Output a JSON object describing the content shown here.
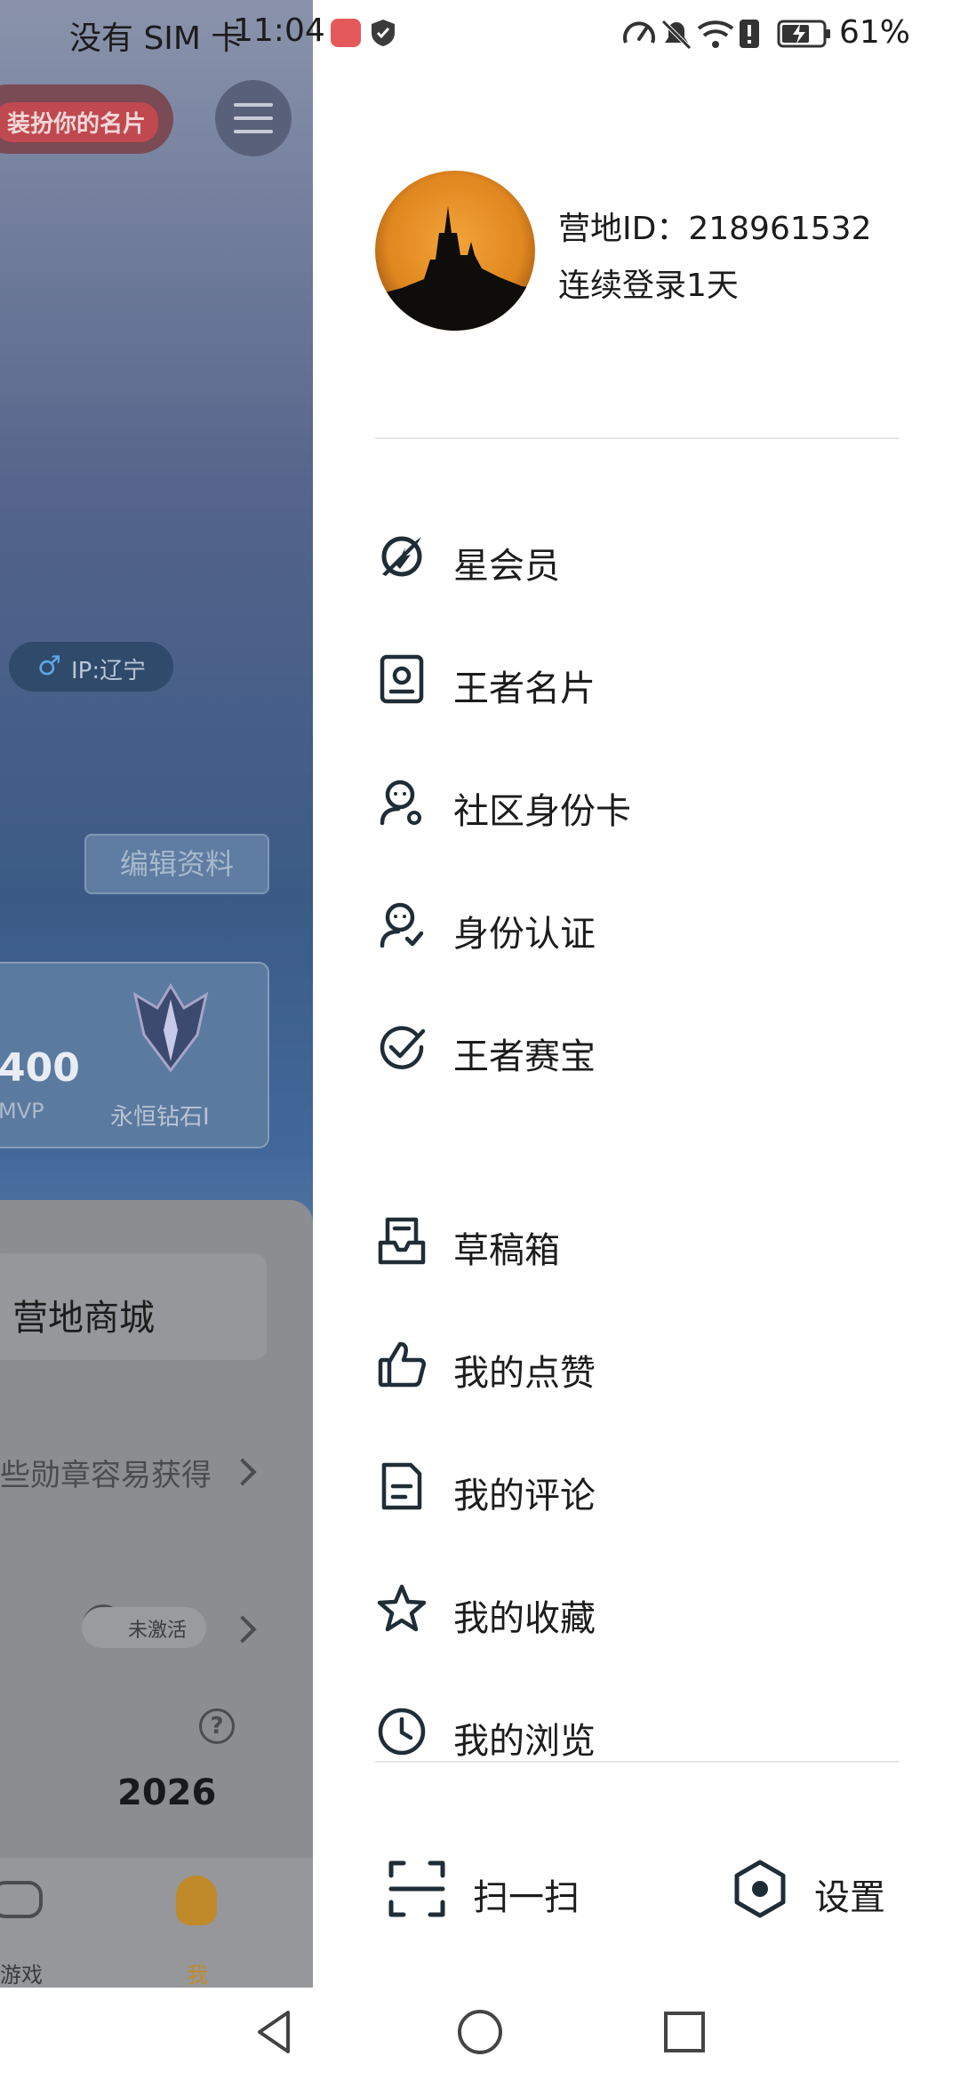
{
  "status_bar": {
    "carrier": "没有 SIM 卡",
    "time": "11:04",
    "battery_percent": "61%",
    "icons": [
      "huawei-app-icon",
      "shield-check-icon",
      "speed-icon",
      "bell-muted-icon",
      "wifi-icon",
      "alert-icon",
      "battery-charging-icon"
    ]
  },
  "background": {
    "dress_button": "装扮你的名片",
    "ip_label": "IP:辽宁",
    "edit_profile": "编辑资料",
    "mvp_count": "400",
    "mvp_label": "MVP",
    "rank_label": "永恒钻石I",
    "shop_label": "营地商城",
    "badges_text": "些勋章容易获得",
    "inactive_label": "未激活",
    "year": "2026",
    "nav_game": "游戏",
    "nav_me": "我"
  },
  "drawer": {
    "camp_id": "营地ID：218961532",
    "login_streak": "连续登录1天",
    "menu_primary": [
      {
        "label": "星会员",
        "icon": "star-member-icon"
      },
      {
        "label": "王者名片",
        "icon": "name-card-icon"
      },
      {
        "label": "社区身份卡",
        "icon": "community-id-card-icon"
      },
      {
        "label": "身份认证",
        "icon": "identity-verify-icon"
      },
      {
        "label": "王者赛宝",
        "icon": "match-treasure-icon"
      }
    ],
    "menu_secondary": [
      {
        "label": "草稿箱",
        "icon": "drafts-icon"
      },
      {
        "label": "我的点赞",
        "icon": "thumbs-up-icon"
      },
      {
        "label": "我的评论",
        "icon": "comment-icon"
      },
      {
        "label": "我的收藏",
        "icon": "star-icon"
      },
      {
        "label": "我的浏览",
        "icon": "history-clock-icon"
      }
    ],
    "scan_label": "扫一扫",
    "settings_label": "设置"
  },
  "colors": {
    "drawer_bg": "#ffffff",
    "text": "#1c1c1c",
    "icon_stroke": "#1f2d36",
    "divider": "#e6e6e6"
  }
}
